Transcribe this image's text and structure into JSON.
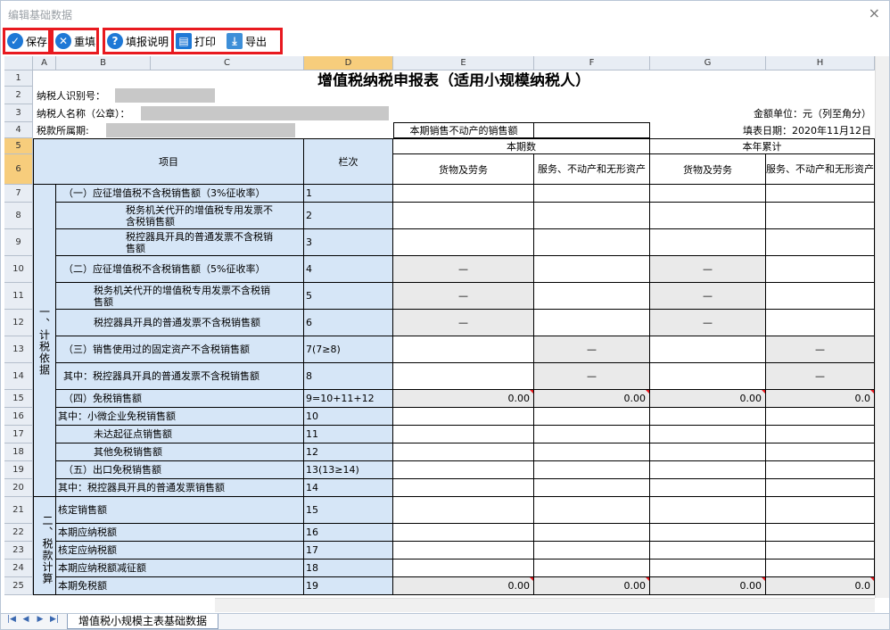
{
  "window": {
    "title": "编辑基础数据",
    "close": "×"
  },
  "toolbar": {
    "save": "保存",
    "reset": "重填",
    "help": "填报说明",
    "print": "打印",
    "export": "导出"
  },
  "columns": [
    "A",
    "B",
    "C",
    "D",
    "E",
    "F",
    "G",
    "H"
  ],
  "rows": [
    "1",
    "2",
    "3",
    "4",
    "5",
    "6",
    "7",
    "8",
    "9",
    "10",
    "11",
    "12",
    "13",
    "14",
    "15",
    "16",
    "17",
    "18",
    "19",
    "20",
    "21",
    "22",
    "23",
    "24",
    "25"
  ],
  "form": {
    "title": "增值税纳税申报表（适用小规模纳税人）",
    "taxpayer_id_label": "纳税人识别号：",
    "taxpayer_name_label": "纳税人名称（公章）：",
    "amount_unit": "金额单位：元（列至角分）",
    "tax_period_label": "税款所属期:",
    "property_sales_label": "本期销售不动产的销售额",
    "fill_date": "填表日期：2020年11月12日",
    "item_header": "项目",
    "line_header": "栏次",
    "current_period": "本期数",
    "year_total": "本年累计",
    "goods_services": "货物及劳务",
    "services_intangibles": "服务、不动产和无形资产",
    "section1": "一、计税依据",
    "section2": "二、税款计算",
    "dash": "—"
  },
  "table_rows": [
    {
      "label": "（一）应征增值税不含税销售额（3%征收率）",
      "line": "1"
    },
    {
      "label": "税务机关代开的增值税专用发票不含税销售额",
      "line": "2"
    },
    {
      "label": "税控器具开具的普通发票不含税销售额",
      "line": "3"
    },
    {
      "label": "（二）应征增值税不含税销售额（5%征收率）",
      "line": "4"
    },
    {
      "label": "税务机关代开的增值税专用发票不含税销售额",
      "line": "5"
    },
    {
      "label": "税控器具开具的普通发票不含税销售额",
      "line": "6"
    },
    {
      "label": "（三）销售使用过的固定资产不含税销售额",
      "line": "7(7≥8)"
    },
    {
      "label": "其中：税控器具开具的普通发票不含税销售额",
      "line": "8"
    },
    {
      "label": "（四）免税销售额",
      "line": "9=10+11+12",
      "e": "0.00",
      "f": "0.00",
      "g": "0.00",
      "h": "0.0"
    },
    {
      "label": "其中：小微企业免税销售额",
      "line": "10"
    },
    {
      "label": "未达起征点销售额",
      "line": "11"
    },
    {
      "label": "其他免税销售额",
      "line": "12"
    },
    {
      "label": "（五）出口免税销售额",
      "line": "13(13≥14)"
    },
    {
      "label": "其中：税控器具开具的普通发票销售额",
      "line": "14"
    },
    {
      "label": "核定销售额",
      "line": "15"
    },
    {
      "label": "本期应纳税额",
      "line": "16"
    },
    {
      "label": "核定应纳税额",
      "line": "17"
    },
    {
      "label": "本期应纳税额减征额",
      "line": "18"
    },
    {
      "label": "本期免税额",
      "line": "19",
      "e": "0.00",
      "f": "0.00",
      "g": "0.00",
      "h": "0.0"
    }
  ],
  "sheet_tab": "增值税小规模主表基础数据",
  "colors": {
    "highlight": "#e8191f",
    "input_blue": "#d6e6f7",
    "header_selected": "#f7cd7c"
  }
}
